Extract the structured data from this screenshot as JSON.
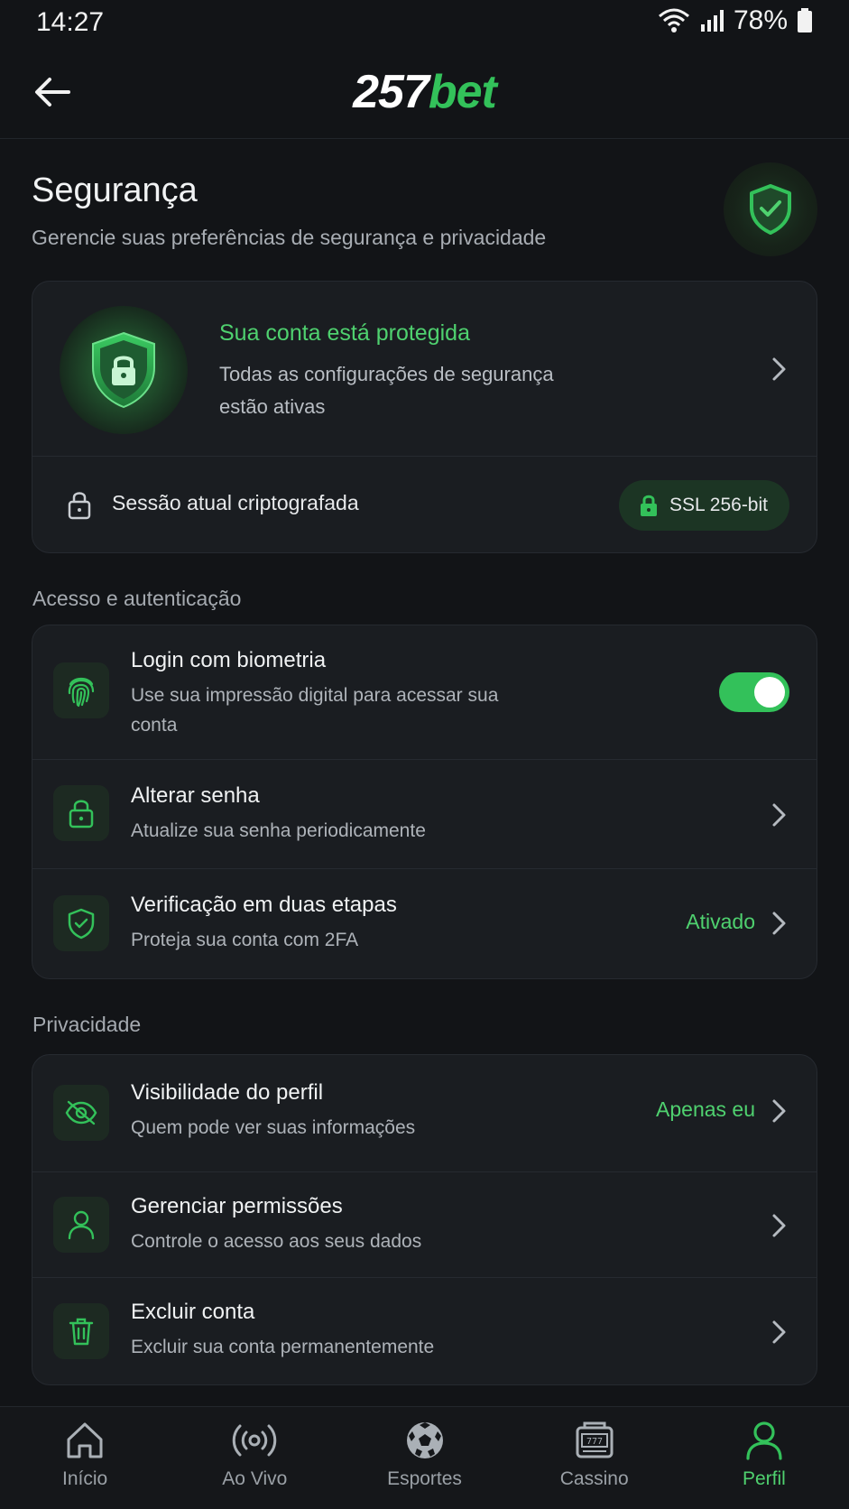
{
  "status_bar": {
    "time": "14:27",
    "battery": "78%"
  },
  "header": {
    "logo_number": "257",
    "logo_brand": "bet"
  },
  "page": {
    "title": "Segurança",
    "subtitle": "Gerencie suas preferências de segurança e privacidade"
  },
  "status_card": {
    "title": "Sua conta está protegida",
    "description": "Todas as configurações de segurança estão ativas",
    "session_text": "Sessão atual criptografada",
    "ssl_badge": "SSL 256-bit"
  },
  "access_section": {
    "label": "Acesso e autenticação",
    "items": [
      {
        "title": "Login com biometria",
        "subtitle": "Use sua impressão digital para acessar sua conta",
        "icon": "fingerprint-icon",
        "toggle_on": true
      },
      {
        "title": "Alterar senha",
        "subtitle": "Atualize sua senha periodicamente",
        "icon": "lock-icon"
      },
      {
        "title": "Verificação em duas etapas",
        "subtitle": "Proteja sua conta com 2FA",
        "value": "Ativado",
        "icon": "shield-check-icon"
      }
    ]
  },
  "privacy_section": {
    "label": "Privacidade",
    "items": [
      {
        "title": "Visibilidade do perfil",
        "subtitle": "Quem pode ver suas informações",
        "value": "Apenas eu",
        "icon": "eye-off-icon"
      },
      {
        "title": "Gerenciar permissões",
        "subtitle": "Controle o acesso aos seus dados",
        "icon": "user-icon"
      },
      {
        "title": "Excluir conta",
        "subtitle": "Excluir sua conta permanentemente",
        "icon": "trash-icon"
      }
    ]
  },
  "bottom_nav": [
    {
      "label": "Início",
      "icon": "home-icon"
    },
    {
      "label": "Ao Vivo",
      "icon": "live-broadcast-icon"
    },
    {
      "label": "Esportes",
      "icon": "soccer-ball-icon"
    },
    {
      "label": "Cassino",
      "icon": "slot-machine-icon"
    },
    {
      "label": "Perfil",
      "icon": "user-icon",
      "active": true
    }
  ],
  "colors": {
    "accent": "#33C15A",
    "accent_text": "#4FD16F",
    "background": "#121417",
    "card": "#1A1D21"
  }
}
